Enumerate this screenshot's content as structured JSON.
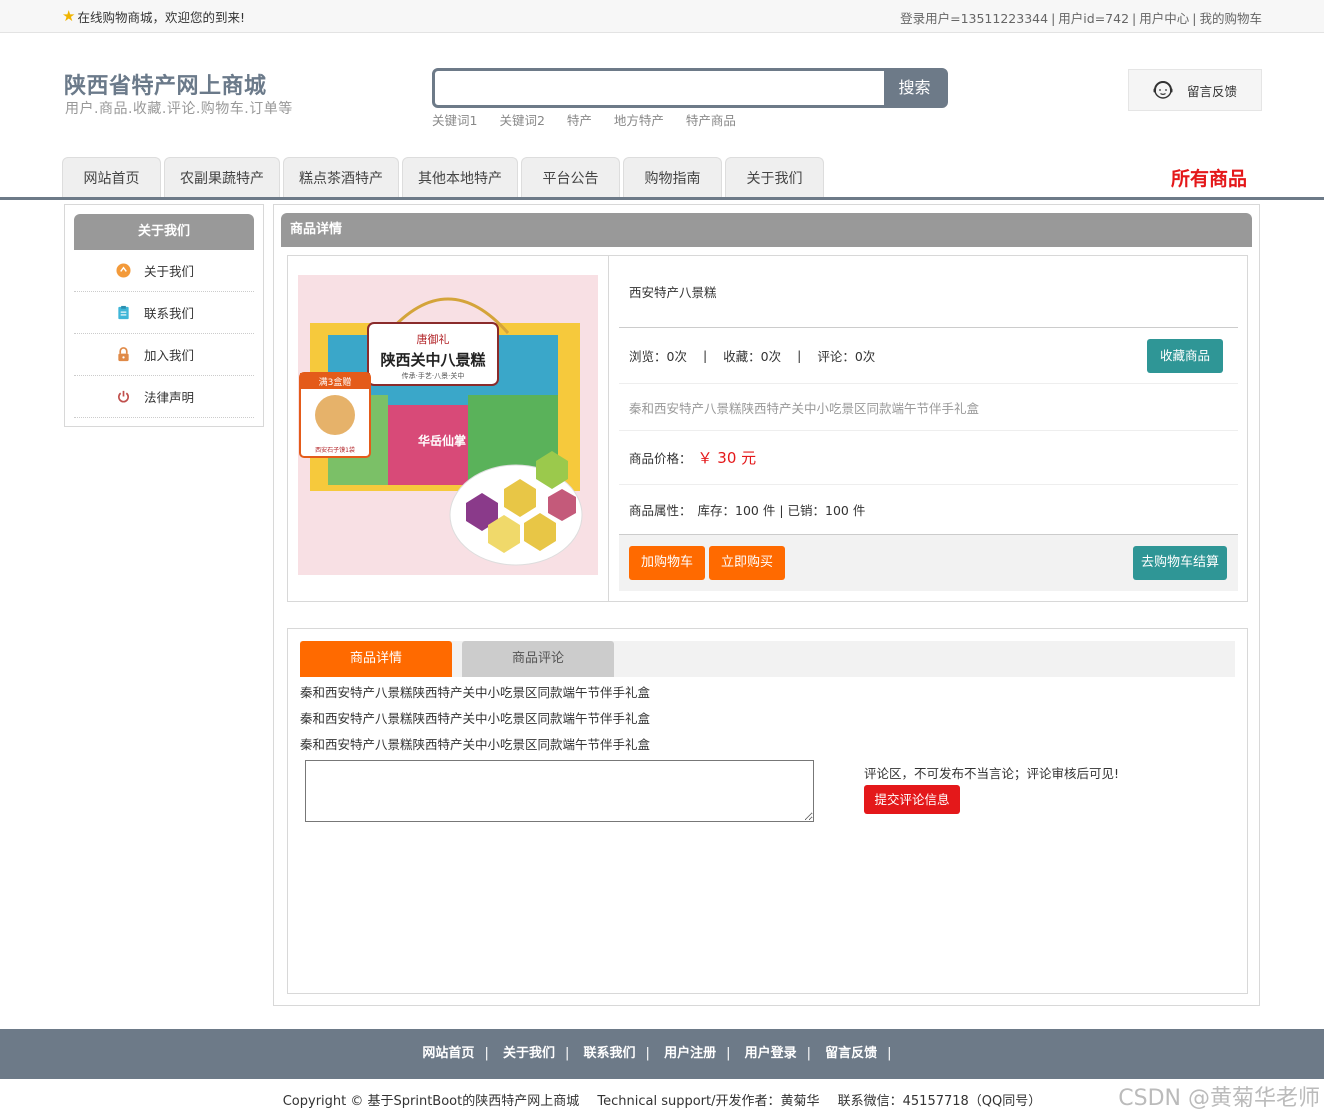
{
  "topbar": {
    "welcome": "在线购物商城，欢迎您的到来!",
    "login_user": "登录用户=13511223344",
    "user_id": "用户id=742",
    "user_center": "用户中心",
    "my_cart": "我的购物车"
  },
  "header": {
    "site_title": "陕西省特产网上商城",
    "site_subtitle": "用户.商品.收藏.评论.购物车.订单等",
    "search": {
      "placeholder": "",
      "button_label": "搜索"
    },
    "keywords": [
      "关键词1",
      "关键词2",
      "特产",
      "地方特产",
      "特产商品"
    ],
    "feedback_label": "留言反馈"
  },
  "nav": {
    "tabs": [
      "网站首页",
      "农副果蔬特产",
      "糕点茶酒特产",
      "其他本地特产",
      "平台公告",
      "购物指南",
      "关于我们"
    ],
    "all_goods": "所有商品"
  },
  "sidebar": {
    "title": "关于我们",
    "items": [
      {
        "label": "关于我们",
        "icon": "orange-circle-icon",
        "color": "#f39a3a"
      },
      {
        "label": "联系我们",
        "icon": "clipboard-icon",
        "color": "#3fb6d8"
      },
      {
        "label": "加入我们",
        "icon": "lock-icon",
        "color": "#e08a48"
      },
      {
        "label": "法律声明",
        "icon": "power-icon",
        "color": "#c0504d"
      }
    ]
  },
  "product": {
    "section_title": "商品详情",
    "name": "西安特产八景糕",
    "views": "浏览：0次",
    "favorites": "收藏：0次",
    "comments": "评论：0次",
    "favorite_button": "收藏商品",
    "description": "秦和西安特产八景糕陕西特产关中小吃景区同款端午节伴手礼盒",
    "price_label": "商品价格：",
    "price_value": "￥ 30 元",
    "attr_label": "商品属性：",
    "attr_value": "库存：100 件 | 已销：100 件",
    "add_cart_button": "加购物车",
    "buy_now_button": "立即购买",
    "checkout_button": "去购物车结算",
    "image_text": {
      "brand": "唐御礼",
      "box_title": "陕西关中八景糕",
      "box_tagline": "传承·手艺·八景·关中",
      "promo": "满3盒赠",
      "promo_sub": "西安石子馍1袋",
      "side_title": "华岳仙掌"
    }
  },
  "tabs_section": {
    "tab_details": "商品详情",
    "tab_comments": "商品评论",
    "desc_lines": [
      "秦和西安特产八景糕陕西特产关中小吃景区同款端午节伴手礼盒",
      "秦和西安特产八景糕陕西特产关中小吃景区同款端午节伴手礼盒",
      "秦和西安特产八景糕陕西特产关中小吃景区同款端午节伴手礼盒"
    ],
    "comment_notice": "评论区，不可发布不当言论；评论审核后可见!",
    "submit_button": "提交评论信息"
  },
  "footer": {
    "links": [
      "网站首页",
      "关于我们",
      "联系我们",
      "用户注册",
      "用户登录",
      "留言反馈"
    ],
    "copyright": "Copyright © 基于SprintBoot的陕西特产网上商城",
    "support": "Technical support/开发作者：黄菊华",
    "contact": "联系微信：45157718（QQ同号）",
    "watermark": "CSDN @黄菊华老师"
  },
  "colors": {
    "accent_gray": "#6d7a88",
    "orange": "#ff6a00",
    "teal": "#2f9696",
    "red": "#e4181a"
  }
}
